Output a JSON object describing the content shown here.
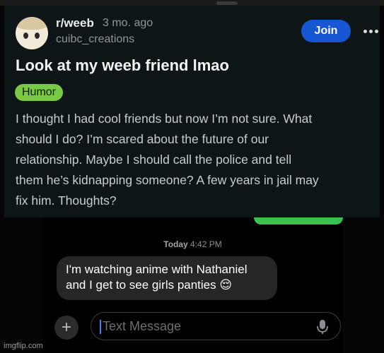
{
  "post": {
    "subreddit": "r/weeb",
    "time_ago": "3 mo. ago",
    "username": "cuibc_creations",
    "join_label": "Join",
    "title": "Look at my weeb friend lmao",
    "flair": "Humor",
    "body": "I thought I had cool friends but now I’m not sure. What\nshould I do? I’m scared about the future of our\nrelationship. Maybe I should call the police and tell\nthem he’s kidnapping someone? A few years in jail may\nfix him. Thoughts?"
  },
  "chat": {
    "day": "Today",
    "time": "4:42 PM",
    "received_message": "I'm watching anime with Nathaniel\nand I get to see girls panties 😌",
    "input_placeholder": "Text Message",
    "plus_label": "+"
  },
  "watermark": "imgflip.com",
  "colors": {
    "card_bg": "#0d1517",
    "join_blue": "#1757d4",
    "flair_green": "#7ac943",
    "sent_green": "#39c152",
    "received_bubble": "#262628"
  }
}
